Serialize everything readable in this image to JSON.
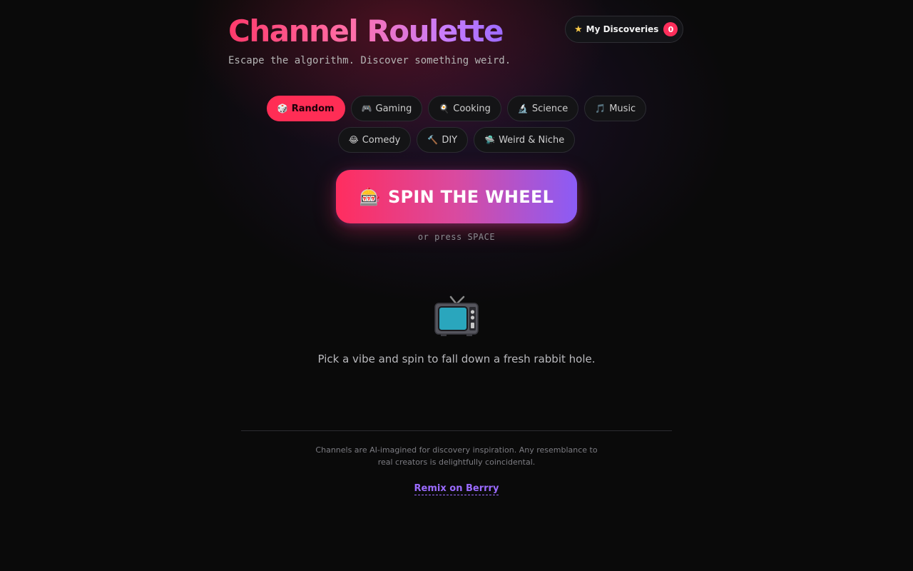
{
  "header": {
    "title": "Channel Roulette",
    "subtitle": "Escape the algorithm. Discover something weird.",
    "discoveries": {
      "icon": "star-icon",
      "label": "My Discoveries",
      "count": "0"
    }
  },
  "categories": [
    {
      "emoji": "🎲",
      "label": "Random",
      "active": true
    },
    {
      "emoji": "🎮",
      "label": "Gaming",
      "active": false
    },
    {
      "emoji": "🍳",
      "label": "Cooking",
      "active": false
    },
    {
      "emoji": "🔬",
      "label": "Science",
      "active": false
    },
    {
      "emoji": "🎵",
      "label": "Music",
      "active": false
    },
    {
      "emoji": "😂",
      "label": "Comedy",
      "active": false
    },
    {
      "emoji": "🔨",
      "label": "DIY",
      "active": false
    },
    {
      "emoji": "🛸",
      "label": "Weird & Niche",
      "active": false
    }
  ],
  "spin": {
    "icon": "🎰",
    "label": "SPIN THE WHEEL",
    "hint": "or press SPACE"
  },
  "empty_state": {
    "icon": "tv-icon",
    "text": "Pick a vibe and spin to fall down a fresh rabbit hole."
  },
  "footer": {
    "note": "Channels are AI-imagined for discovery inspiration. Any resemblance to real creators is delightfully coincidental.",
    "remix_label": "Remix on Berrry"
  },
  "colors": {
    "accent": "#ff2d55",
    "gradient_start": "#ff2d5f",
    "gradient_end": "#8b5cf6",
    "link": "#9b6bff"
  }
}
